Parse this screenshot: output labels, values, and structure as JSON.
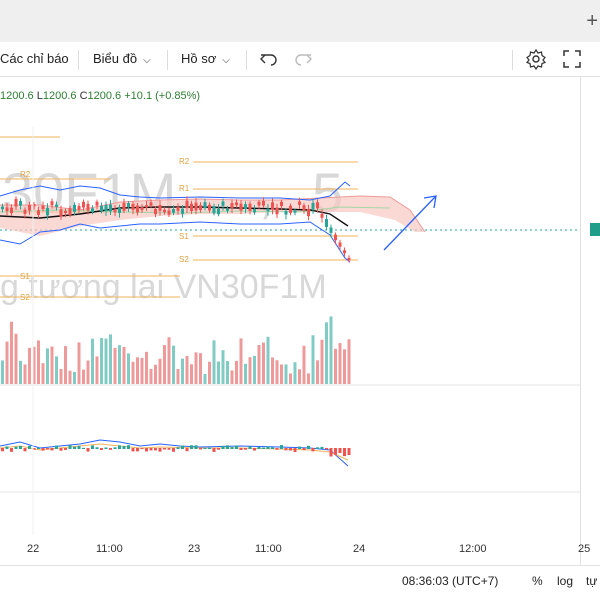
{
  "toolbar": {
    "indicators_label": "Các chỉ báo",
    "chart_type_label": "Biểu đồ",
    "profile_label": "Hồ sơ",
    "undo_icon": "undo-icon",
    "redo_icon": "redo-icon",
    "settings_icon": "gear-icon",
    "fullscreen_icon": "fullscreen-icon"
  },
  "legend": {
    "open": "1200.6",
    "low_prefix": "L",
    "low": "1200.6",
    "close_prefix": "C",
    "close": "1200.6",
    "change": "+10.1",
    "change_pct": "(+0.85%)"
  },
  "watermark": {
    "symbol": "30F1M",
    "interval": "5",
    "separator": ",",
    "description": "g tương lai VN30F1M"
  },
  "pivot_labels": {
    "r2": "R2",
    "r1": "R1",
    "s1": "S1",
    "s2": "S2"
  },
  "x_axis": {
    "ticks": [
      "22",
      "11:00",
      "23",
      "11:00",
      "24",
      "12:00",
      "25"
    ]
  },
  "status_bar": {
    "time": "08:36:03 (UTC+7)",
    "percent": "%",
    "log": "log",
    "auto": "tự"
  },
  "colors": {
    "up": "#26a69a",
    "down": "#ef5350",
    "up_volume": "#80cbc4",
    "down_volume": "#ef9a9a",
    "pivot": "#f0b35a",
    "bollinger": "#2962ff",
    "ema": "#111111",
    "cloud": "#f8c7c2",
    "arrow": "#2962ff",
    "price_tag": "#1f9e8a"
  }
}
